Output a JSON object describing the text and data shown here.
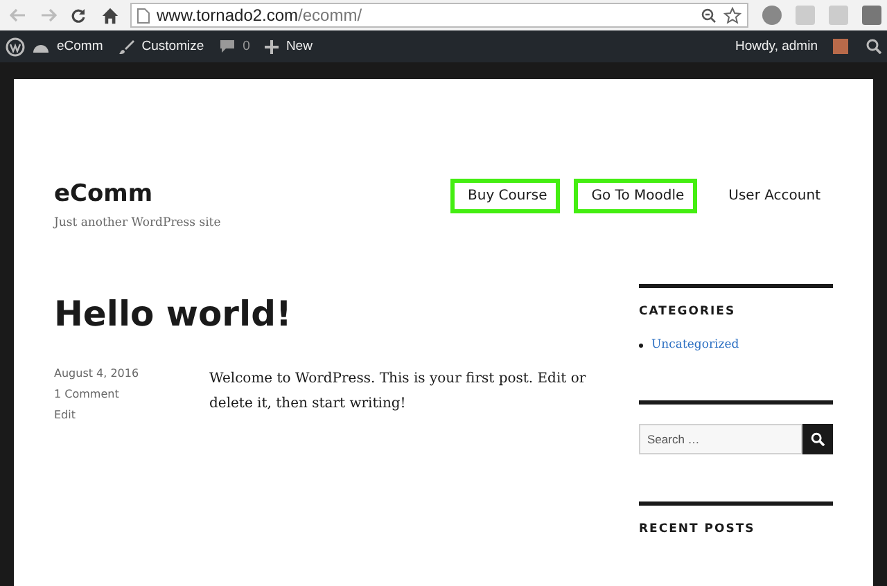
{
  "browser": {
    "url_host": "www.tornado2.com",
    "url_path": "/ecomm/"
  },
  "admin_bar": {
    "site": "eComm",
    "customize": "Customize",
    "comments": "0",
    "new": "New",
    "greeting": "Howdy, admin"
  },
  "site": {
    "title": "eComm",
    "tagline": "Just another WordPress site"
  },
  "nav": [
    {
      "label": "Buy Course",
      "highlighted": true
    },
    {
      "label": "Go To Moodle",
      "highlighted": true
    },
    {
      "label": "User Account",
      "highlighted": false
    }
  ],
  "post": {
    "title": "Hello world!",
    "date": "August 4, 2016",
    "comments": "1 Comment",
    "edit": "Edit",
    "body": "Welcome to WordPress. This is your first post. Edit or delete it, then start writing!"
  },
  "sidebar": {
    "categories_title": "CATEGORIES",
    "categories": [
      "Uncategorized"
    ],
    "search_placeholder": "Search …",
    "recent_title": "RECENT POSTS"
  }
}
